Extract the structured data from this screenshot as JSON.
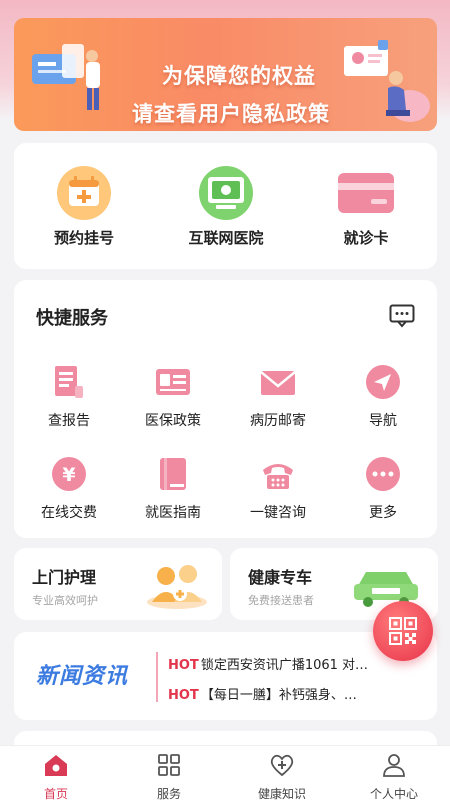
{
  "banner": {
    "line1": "为保障您的权益",
    "line2": "请查看用户隐私政策"
  },
  "main_services": [
    {
      "label": "预约挂号",
      "icon": "calendar-add-icon"
    },
    {
      "label": "互联网医院",
      "icon": "monitor-icon"
    },
    {
      "label": "就诊卡",
      "icon": "card-icon"
    }
  ],
  "quick_services": {
    "title": "快捷服务",
    "items": [
      {
        "label": "查报告",
        "icon": "report-icon"
      },
      {
        "label": "医保政策",
        "icon": "insurance-card-icon"
      },
      {
        "label": "病历邮寄",
        "icon": "mail-icon"
      },
      {
        "label": "导航",
        "icon": "navigation-icon"
      },
      {
        "label": "在线交费",
        "icon": "yuan-icon"
      },
      {
        "label": "就医指南",
        "icon": "book-icon"
      },
      {
        "label": "一键咨询",
        "icon": "phone-icon"
      },
      {
        "label": "更多",
        "icon": "more-icon"
      }
    ]
  },
  "home_care": {
    "title": "上门护理",
    "subtitle": "专业高效呵护"
  },
  "health_car": {
    "title": "健康专车",
    "subtitle": "免费接送患者"
  },
  "news": {
    "logo": "新闻资讯",
    "items": [
      {
        "tag": "HOT",
        "text": "锁定西安资讯广播1061 对…"
      },
      {
        "tag": "HOT",
        "text": "【每日一膳】补钙强身、…"
      }
    ]
  },
  "tabs": [
    {
      "label": "首页",
      "active": true
    },
    {
      "label": "服务",
      "active": false
    },
    {
      "label": "健康知识",
      "active": false
    },
    {
      "label": "个人中心",
      "active": false
    }
  ],
  "colors": {
    "accent": "#d93a55",
    "banner": "#fb9a5a",
    "icon_pink": "#f08aa0"
  }
}
